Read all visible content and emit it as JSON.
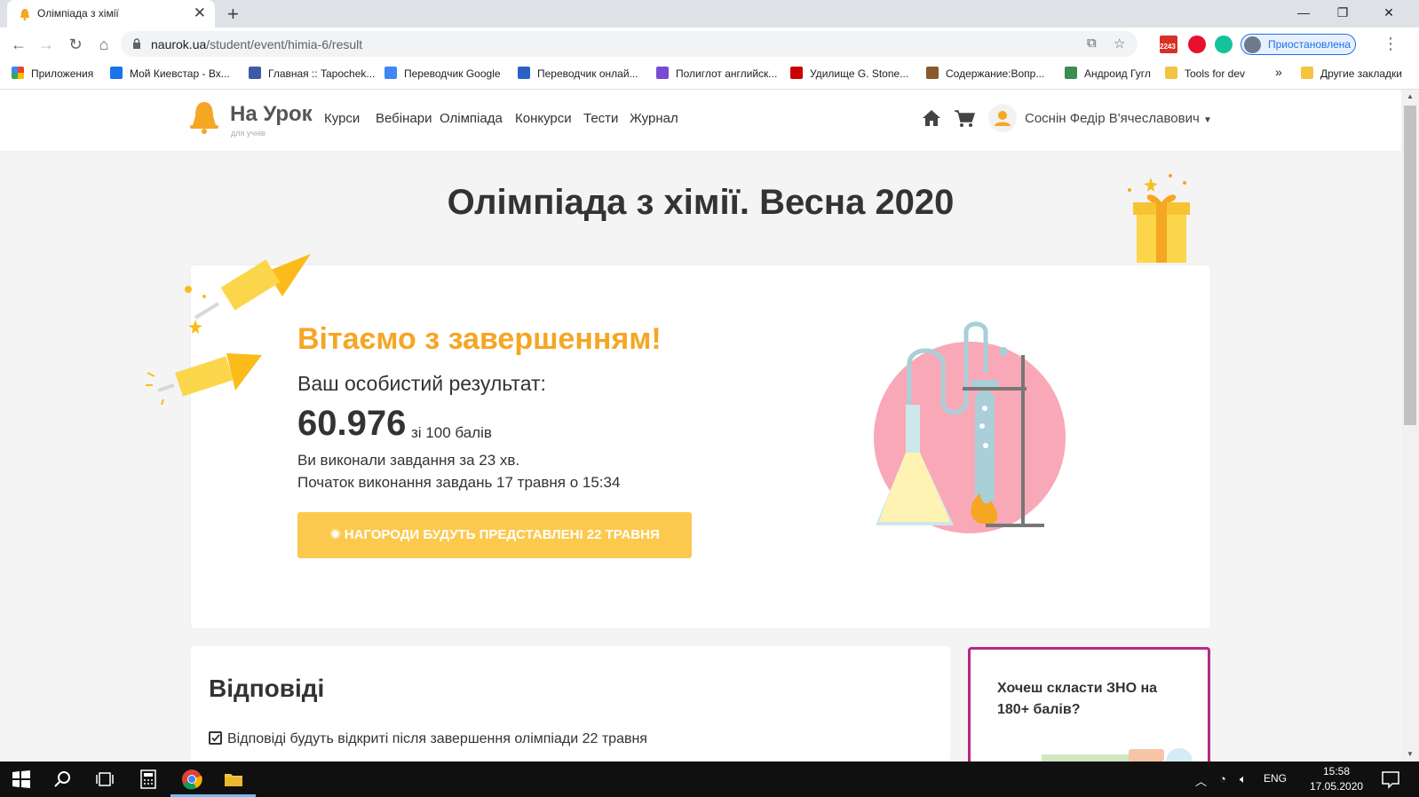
{
  "browser": {
    "tab_title": "Олімпіада з хімії",
    "url_host": "naurok.ua",
    "url_path": "/student/event/himia-6/result",
    "profile_label": "Приостановлена",
    "mail_badge": "2243"
  },
  "bookmarks": [
    {
      "label": "Приложения",
      "color": "#ea4335"
    },
    {
      "label": "Мой Киевстар - Вх...",
      "color": "#1a73e8"
    },
    {
      "label": "Главная :: Tapochek...",
      "color": "#3b5ba5"
    },
    {
      "label": "Переводчик Google",
      "color": "#4285f4"
    },
    {
      "label": "Переводчик онлай...",
      "color": "#2a61c9"
    },
    {
      "label": "Полиглот английск...",
      "color": "#7a4bd2"
    },
    {
      "label": "Удилище G. Stone...",
      "color": "#cc0000"
    },
    {
      "label": "Содержание:Вопр...",
      "color": "#8b5a2b"
    },
    {
      "label": "Андроид Гугл",
      "color": "#3c8d50"
    },
    {
      "label": "Tools for dev",
      "color": "#f5c542"
    },
    {
      "label": "Другие закладки",
      "color": "#f5c542"
    }
  ],
  "site": {
    "logo_text": "На Урок",
    "logo_sub": "для учнів",
    "nav": [
      "Курси",
      "Вебінари",
      "Олімпіада",
      "Конкурси",
      "Тести",
      "Журнал"
    ],
    "user_name": "Соснін Федір В'ячеславович",
    "accent": "#f5a623"
  },
  "content": {
    "page_title": "Олімпіада з хімії. Весна 2020",
    "congrats": "Вітаємо з завершенням!",
    "result_label": "Ваш особистий результат:",
    "score": "60.976",
    "score_of": "зі 100 балів",
    "time_line": "Ви виконали завдання за 23 хв.",
    "start_line": "Початок виконання завдань 17 травня о 15:34",
    "award_button": "НАГОРОДИ БУДУТЬ ПРЕДСТАВЛЕНІ 22 ТРАВНЯ",
    "answers_title": "Відповіді",
    "answers_note": "Відповіді будуть відкриті після завершення олімпіади 22 травня",
    "promo_text": "Хочеш скласти ЗНО на 180+ балів?"
  },
  "taskbar": {
    "lang": "ENG",
    "time": "15:58",
    "date": "17.05.2020"
  }
}
